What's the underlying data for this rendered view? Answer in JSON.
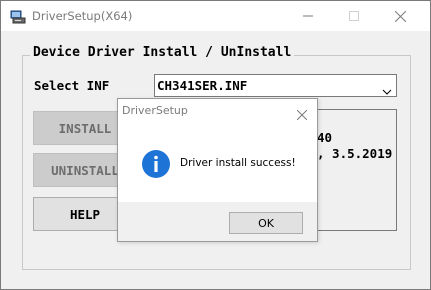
{
  "window": {
    "title": "DriverSetup(X64)",
    "icon": "driver-setup-app-icon"
  },
  "group": {
    "title": "Device Driver Install / UnInstall"
  },
  "select_inf": {
    "label": "Select INF",
    "value": "CH341SER.INF"
  },
  "buttons": {
    "install": "INSTALL",
    "uninstall": "UNINSTALL",
    "help": "HELP"
  },
  "info": {
    "line1_visible": "40",
    "line2_visible": ", 3.5.2019"
  },
  "dialog": {
    "title": "DriverSetup",
    "message": "Driver install success!",
    "ok_label": "OK",
    "icon": "info-icon"
  },
  "colors": {
    "info_blue": "#1e74d6",
    "disabled_button": "#cccccc"
  }
}
